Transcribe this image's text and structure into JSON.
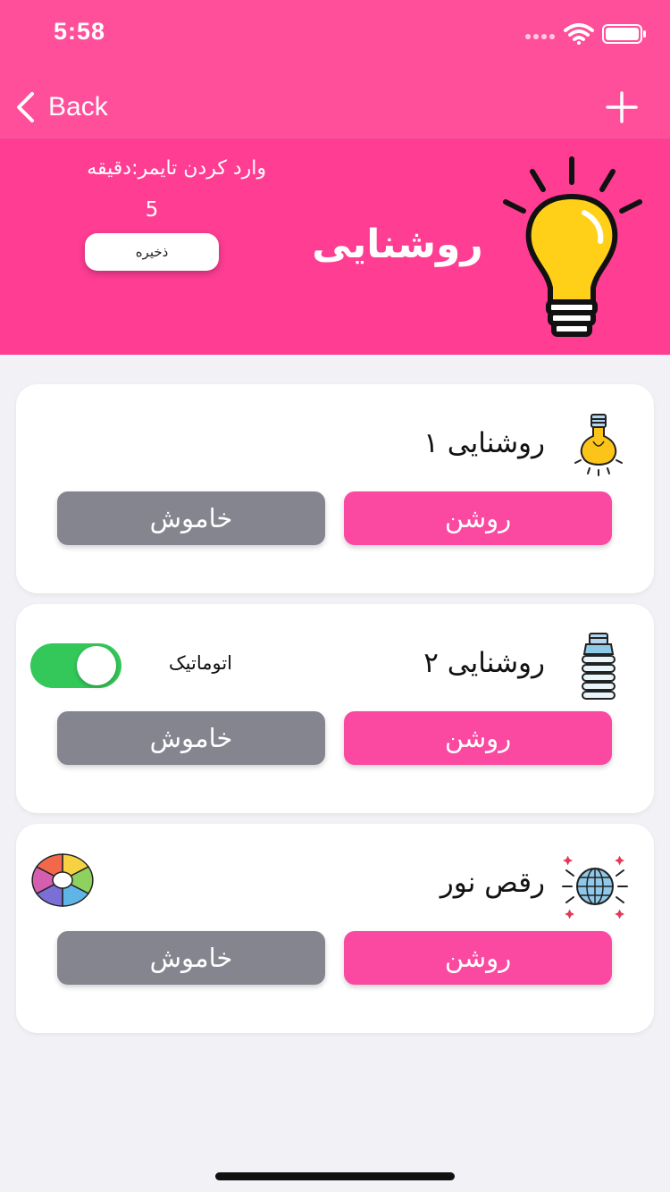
{
  "status_bar": {
    "time": "5:58"
  },
  "nav": {
    "back_label": "Back"
  },
  "header": {
    "timer_label": "وارد کردن تایمر:دقیقه",
    "timer_value": "5",
    "save_label": "ذخیره",
    "title": "روشنایی"
  },
  "cards": [
    {
      "title": "روشنایی ۱",
      "on_label": "روشن",
      "off_label": "خاموش",
      "icon": "bulb-icon"
    },
    {
      "title": "روشنایی ۲",
      "on_label": "روشن",
      "off_label": "خاموش",
      "icon": "cfl-bulb-icon",
      "auto_label": "اتوماتیک",
      "auto_enabled": true
    },
    {
      "title": "رقص نور",
      "on_label": "روشن",
      "off_label": "خاموش",
      "icon": "disco-ball-icon",
      "extra_icon": "color-wheel-icon"
    }
  ],
  "colors": {
    "accent": "#ff4f9a",
    "header": "#fe3d93",
    "on_button": "#fb48a0",
    "off_button": "#84858f",
    "toggle_on": "#34c759"
  }
}
